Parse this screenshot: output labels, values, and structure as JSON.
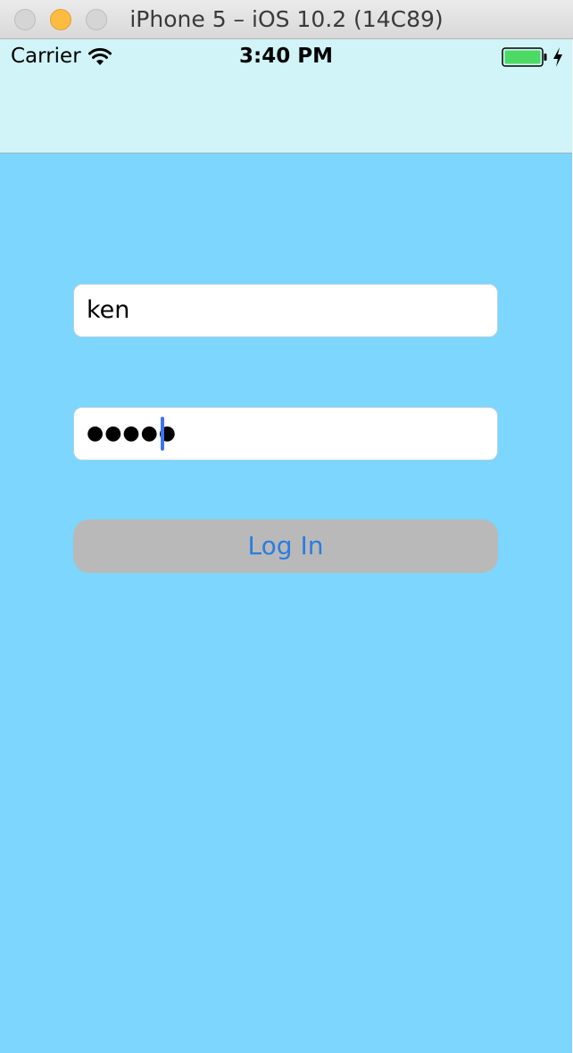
{
  "window": {
    "title": "iPhone 5 – iOS 10.2 (14C89)"
  },
  "status_bar": {
    "carrier": "Carrier",
    "time": "3:40 PM",
    "battery_icon": "battery-full-icon",
    "wifi_icon": "wifi-icon",
    "charging_icon": "charging-bolt-icon"
  },
  "login_form": {
    "username_value": "ken",
    "password_masked": "●●●●●",
    "login_button_label": "Log In"
  },
  "colors": {
    "screen_background": "#7cd6fd",
    "nav_bar_background": "#d0f4f8",
    "button_background": "#b9b9b9",
    "button_text": "#2a7de1",
    "caret": "#3f72ee",
    "battery_fill": "#4cd964"
  }
}
